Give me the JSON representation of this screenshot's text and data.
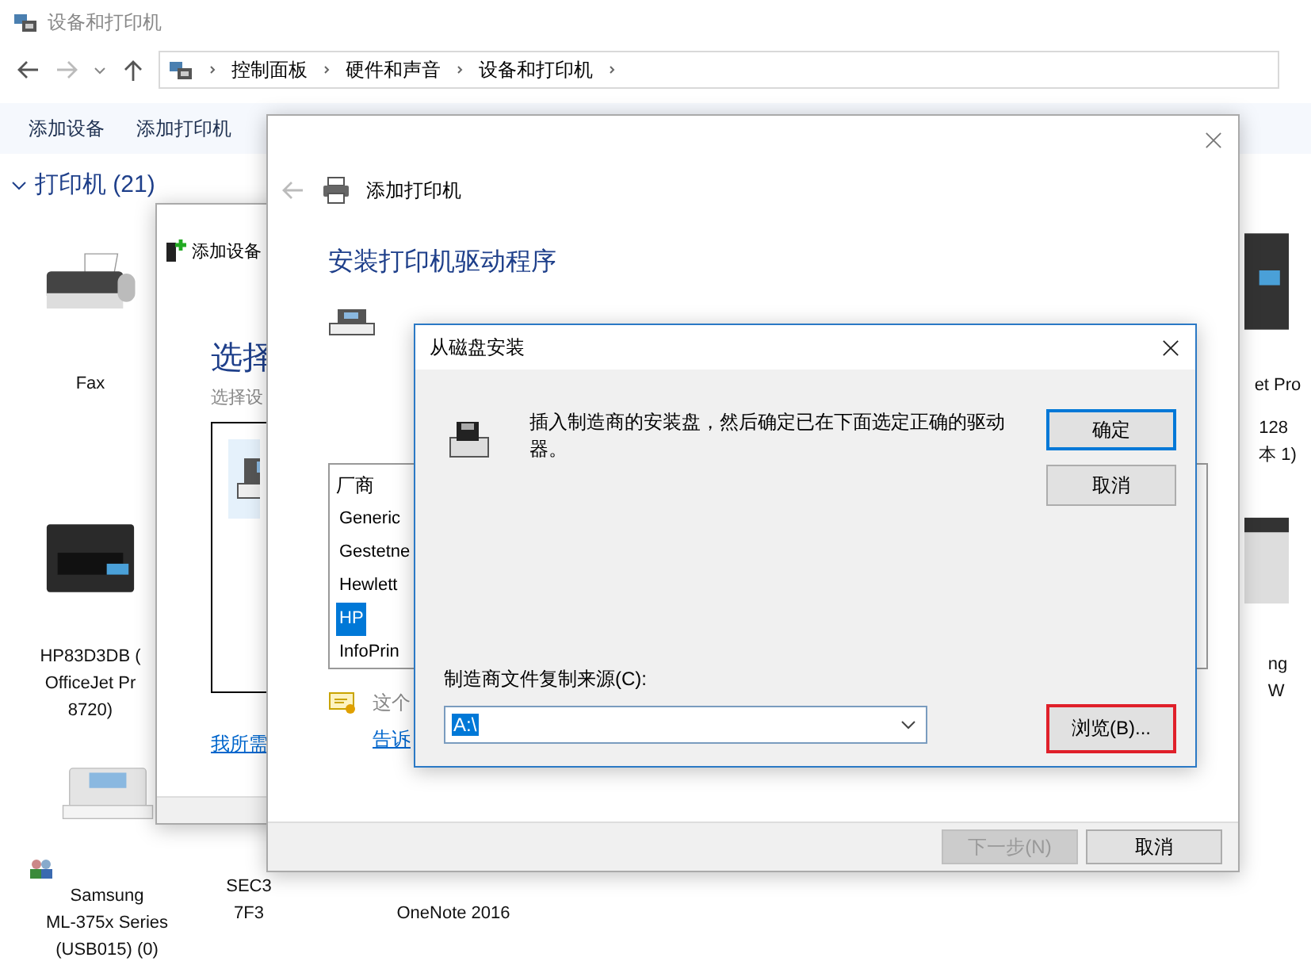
{
  "explorer": {
    "title": "设备和打印机",
    "breadcrumb": [
      "控制面板",
      "硬件和声音",
      "设备和打印机"
    ],
    "toolbar": [
      "添加设备",
      "添加打印机"
    ],
    "group": {
      "label": "打印机 (21)",
      "expanded": true
    },
    "devices": [
      {
        "kind": "fax",
        "lines": [
          "Fax"
        ]
      },
      {
        "kind": "inkjet",
        "lines": [
          "HP83D3DB (",
          "OfficeJet Pr",
          "8720)"
        ]
      },
      {
        "kind": "laser",
        "lines": [
          "Samsung",
          "ML-375x Series",
          "(USB015) (0)"
        ],
        "shared": true
      },
      {
        "kind": "none",
        "lines": [
          "SEC3",
          "7F3"
        ]
      },
      {
        "kind": "none",
        "lines": [
          "OneNote 2016"
        ]
      },
      {
        "kind": "dark",
        "lines": [
          "et Pro"
        ]
      },
      {
        "kind": "none",
        "lines": [
          "128",
          "本 1)"
        ]
      },
      {
        "kind": "mfp",
        "lines": [
          "ng",
          "W"
        ]
      }
    ]
  },
  "add_device": {
    "title": "添加设备",
    "heading": "选择",
    "subtitle": "选择设",
    "link": "我所需"
  },
  "add_printer": {
    "title": "添加打印机",
    "heading": "安装打印机驱动程序",
    "list": {
      "header": "厂商",
      "items": [
        {
          "label": "Generic",
          "selected": false
        },
        {
          "label": "Gestetne",
          "selected": false
        },
        {
          "label": "Hewlett",
          "selected": false
        },
        {
          "label": "HP",
          "selected": true
        },
        {
          "label": "InfoPrin",
          "selected": false
        }
      ]
    },
    "note": "这个",
    "link": "告诉",
    "buttons": [
      {
        "label": "下一步(N)",
        "disabled": true
      },
      {
        "label": "取消",
        "disabled": false
      }
    ]
  },
  "dialog": {
    "title": "从磁盘安装",
    "message": "插入制造商的安装盘，然后确定已在下面选定正确的驱动器。",
    "buttons": [
      {
        "label": "确定",
        "default": true
      },
      {
        "label": "取消",
        "default": false
      }
    ],
    "source_label": "制造商文件复制来源(C):",
    "source_value": "A:\\",
    "browse": {
      "label": "浏览(B)...",
      "highlighted": true
    }
  }
}
